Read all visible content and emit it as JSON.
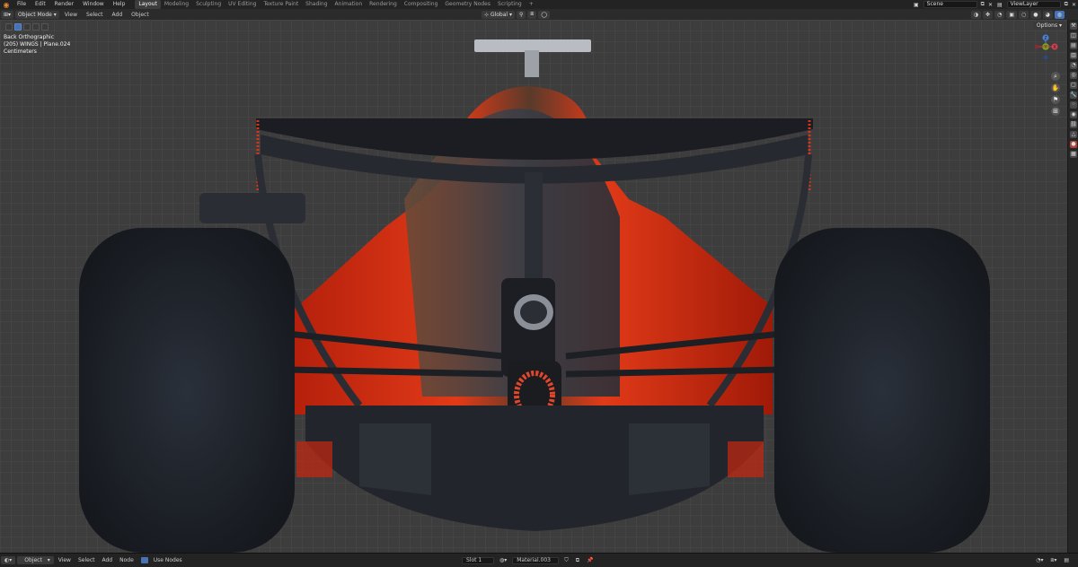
{
  "app": {
    "logo_icon": "blender-logo-icon"
  },
  "menu": [
    "File",
    "Edit",
    "Render",
    "Window",
    "Help"
  ],
  "workspaces": [
    "Layout",
    "Modeling",
    "Sculpting",
    "UV Editing",
    "Texture Paint",
    "Shading",
    "Animation",
    "Rendering",
    "Compositing",
    "Geometry Nodes",
    "Scripting",
    "+"
  ],
  "active_workspace": "Layout",
  "scene": {
    "label": "Scene",
    "view_layer": "ViewLayer"
  },
  "header": {
    "mode": "Object Mode",
    "menus": [
      "View",
      "Select",
      "Add",
      "Object"
    ],
    "transform_orientation": "Global",
    "options": "Options"
  },
  "viewport": {
    "view_name": "Back Orthographic",
    "object_info": "(205) WINGS | Plane.024",
    "units": "Centimeters"
  },
  "gizmo": {
    "x": "X",
    "y": "Y",
    "z": "Z"
  },
  "bottom": {
    "editor": "Object",
    "menus": [
      "View",
      "Select",
      "Add",
      "Node"
    ],
    "use_nodes": "Use Nodes",
    "slot": "Slot 1",
    "material": "Material.003"
  },
  "colors": {
    "accent": "#4772b3",
    "car_red": "#c8260f",
    "wheel": "#1e232b"
  }
}
